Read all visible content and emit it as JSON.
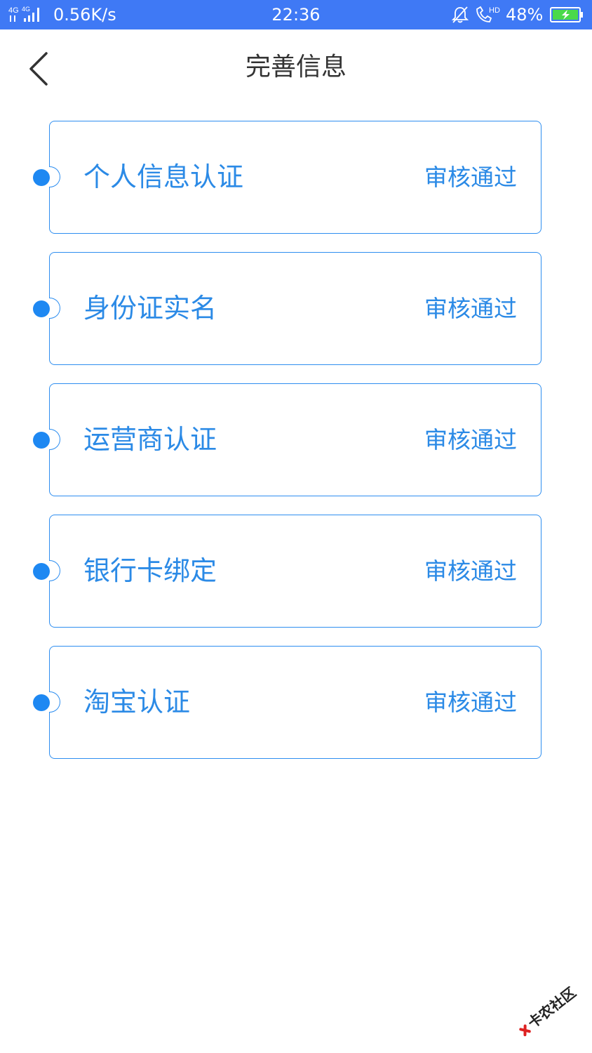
{
  "status_bar": {
    "network": "4G 4G",
    "speed": "0.56K/s",
    "time": "22:36",
    "call_badge": "HD",
    "battery": "48%",
    "color": "#3f79f5"
  },
  "header": {
    "title": "完善信息",
    "back_icon": "chevron-left-icon"
  },
  "items": [
    {
      "label": "个人信息认证",
      "status": "审核通过"
    },
    {
      "label": "身份证实名",
      "status": "审核通过"
    },
    {
      "label": "运营商认证",
      "status": "审核通过"
    },
    {
      "label": "银行卡绑定",
      "status": "审核通过"
    },
    {
      "label": "淘宝认证",
      "status": "审核通过"
    }
  ],
  "accent_color": "#2b8ae6",
  "watermark": {
    "text": "卡农社区"
  }
}
